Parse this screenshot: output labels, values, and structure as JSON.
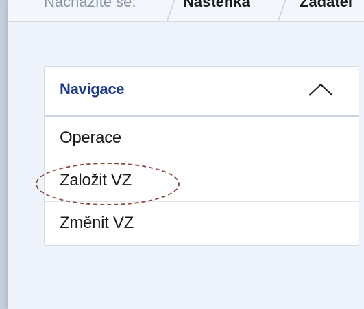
{
  "breadcrumb": {
    "label": "Nacházíte se:",
    "items": [
      "Nástěnka",
      "Žadatel"
    ]
  },
  "navigation": {
    "title": "Navigace",
    "toggle_icon": "chevron-up-icon",
    "items": [
      {
        "label": "Operace"
      },
      {
        "label": "Založit VZ"
      },
      {
        "label": "Změnit VZ"
      }
    ]
  },
  "colors": {
    "title_blue": "#1f3a8c",
    "annotation": "#8a4b42",
    "background": "#eef2fb"
  }
}
